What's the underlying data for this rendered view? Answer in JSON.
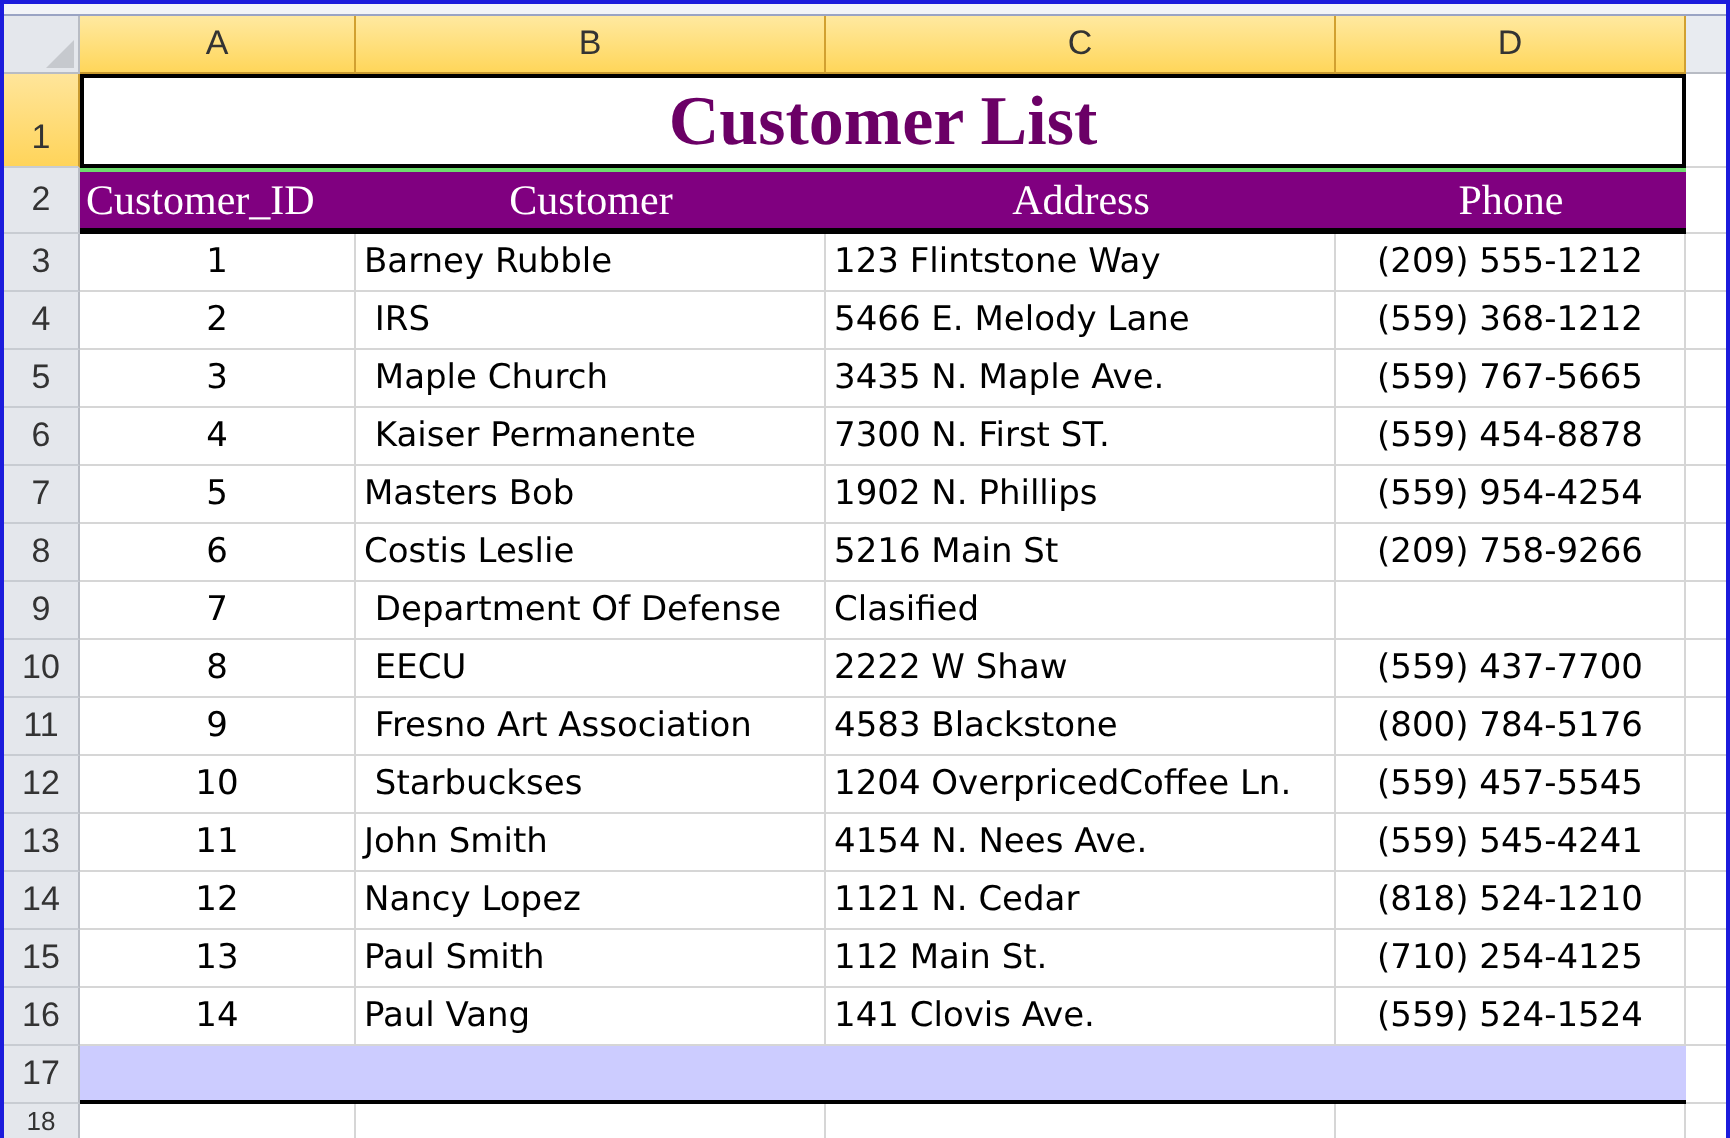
{
  "columns": [
    {
      "label": "A",
      "selected": true
    },
    {
      "label": "B",
      "selected": true
    },
    {
      "label": "C",
      "selected": true
    },
    {
      "label": "D",
      "selected": true
    }
  ],
  "title_row": {
    "row_label": "1",
    "selected": true,
    "text": "Customer List"
  },
  "header_row": {
    "row_label": "2",
    "selected": false,
    "cells": [
      "Customer_ID",
      "Customer",
      "Address",
      "Phone"
    ]
  },
  "data_rows": [
    {
      "row_label": "3",
      "selected": false,
      "id": "1",
      "customer": "Barney Rubble",
      "address": "123 Flintstone Way",
      "phone": "(209) 555-1212"
    },
    {
      "row_label": "4",
      "selected": false,
      "id": "2",
      "customer": " IRS",
      "address": "5466 E. Melody Lane",
      "phone": "(559) 368-1212"
    },
    {
      "row_label": "5",
      "selected": false,
      "id": "3",
      "customer": " Maple Church",
      "address": "3435 N. Maple Ave.",
      "phone": "(559) 767-5665"
    },
    {
      "row_label": "6",
      "selected": false,
      "id": "4",
      "customer": " Kaiser Permanente",
      "address": "7300 N. First ST.",
      "phone": "(559) 454-8878"
    },
    {
      "row_label": "7",
      "selected": false,
      "id": "5",
      "customer": "Masters Bob",
      "address": "1902 N. Phillips",
      "phone": "(559) 954-4254"
    },
    {
      "row_label": "8",
      "selected": false,
      "id": "6",
      "customer": "Costis Leslie",
      "address": "5216 Main St",
      "phone": "(209) 758-9266"
    },
    {
      "row_label": "9",
      "selected": false,
      "id": "7",
      "customer": " Department Of Defense",
      "address": "Clasified"
    },
    {
      "row_label": "10",
      "selected": false,
      "id": "8",
      "customer": " EECU",
      "address": "2222 W Shaw",
      "phone": "(559) 437-7700"
    },
    {
      "row_label": "11",
      "selected": false,
      "id": "9",
      "customer": " Fresno Art Association",
      "address": "4583 Blackstone",
      "phone": "(800) 784-5176"
    },
    {
      "row_label": "12",
      "selected": false,
      "id": "10",
      "customer": " Starbuckses",
      "address": "1204 OverpricedCoffee Ln.",
      "phone": "(559) 457-5545"
    },
    {
      "row_label": "13",
      "selected": false,
      "id": "11",
      "customer": "John Smith",
      "address": "4154 N. Nees Ave.",
      "phone": "(559) 545-4241"
    },
    {
      "row_label": "14",
      "selected": false,
      "id": "12",
      "customer": "Nancy Lopez",
      "address": "1121 N. Cedar",
      "phone": "(818) 524-1210"
    },
    {
      "row_label": "15",
      "selected": false,
      "id": "13",
      "customer": "Paul Smith",
      "address": "112 Main St.",
      "phone": "(710) 254-4125"
    },
    {
      "row_label": "16",
      "selected": false,
      "id": "14",
      "customer": "Paul Vang",
      "address": "141 Clovis Ave.",
      "phone": "(559) 524-1524"
    }
  ],
  "extra_rows": [
    {
      "row_label": "17",
      "selected": false,
      "highlighted": true
    },
    {
      "row_label": "18",
      "selected": false,
      "highlighted": false
    }
  ]
}
